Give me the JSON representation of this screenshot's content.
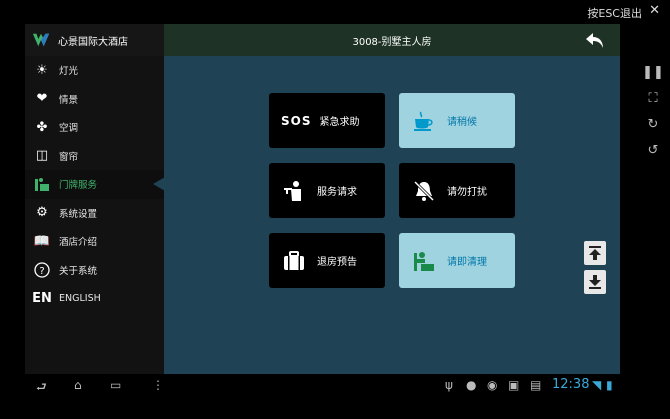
{
  "system": {
    "exit_hint": "按ESC退出",
    "clock": "12:38"
  },
  "brand": {
    "title": "心景国际大酒店",
    "accent": "#3fb36b"
  },
  "sidebar": {
    "items": [
      {
        "label": "灯光",
        "icon": "light-icon"
      },
      {
        "label": "情景",
        "icon": "scene-icon"
      },
      {
        "label": "空调",
        "icon": "fan-icon"
      },
      {
        "label": "窗帘",
        "icon": "curtain-icon"
      },
      {
        "label": "门牌服务",
        "icon": "doorplate-service-icon",
        "active": true
      },
      {
        "label": "系统设置",
        "icon": "gear-icon"
      },
      {
        "label": "酒店介绍",
        "icon": "book-icon"
      },
      {
        "label": "关于系统",
        "icon": "question-icon"
      },
      {
        "label": "ENGLISH",
        "icon_text": "EN"
      }
    ]
  },
  "header": {
    "title": "3008-别墅主人房"
  },
  "tiles": [
    {
      "label": "紧急求助",
      "prefix": "SOS",
      "style": "dark"
    },
    {
      "label": "请稍候",
      "icon": "coffee-icon",
      "style": "light"
    },
    {
      "label": "服务请求",
      "icon": "waiter-icon",
      "style": "dark"
    },
    {
      "label": "请勿打扰",
      "icon": "mute-bell-icon",
      "style": "dark"
    },
    {
      "label": "退房预告",
      "icon": "luggage-icon",
      "style": "dark"
    },
    {
      "label": "请即清理",
      "icon": "cleaning-icon",
      "style": "light"
    }
  ]
}
